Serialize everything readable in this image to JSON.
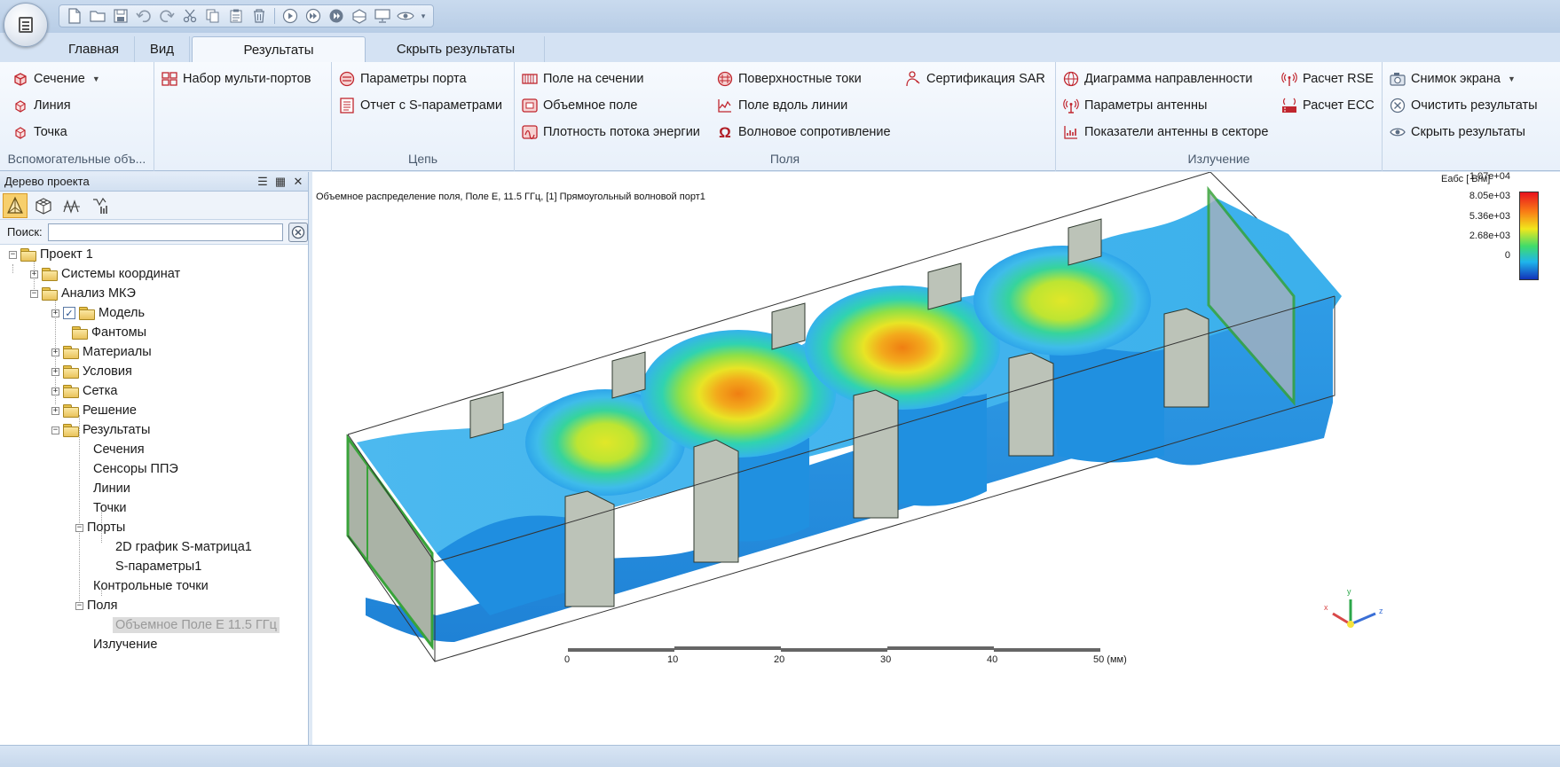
{
  "qat": {
    "icons": [
      "new-file-icon",
      "open-folder-icon",
      "save-icon",
      "undo-icon",
      "redo-icon",
      "cut-icon",
      "copy-icon",
      "paste-icon",
      "delete-icon",
      "play-icon",
      "step-icon",
      "run-icon",
      "mesh-icon",
      "screen-icon",
      "eye-icon"
    ]
  },
  "tabs": [
    {
      "label": "Главная"
    },
    {
      "label": "Вид"
    },
    {
      "label": "Результаты",
      "active": true
    },
    {
      "label": "Скрыть результаты"
    }
  ],
  "ribbon": {
    "aux": {
      "caption": "Вспомогательные объ...",
      "section": "Сечение",
      "line": "Линия",
      "point": "Точка"
    },
    "multiport": {
      "set": "Набор мульти-портов"
    },
    "circuit": {
      "caption": "Цепь",
      "port_params": "Параметры порта",
      "sparam_report": "Отчет с S-параметрами"
    },
    "fields": {
      "caption": "Поля",
      "field_section": "Поле на сечении",
      "volume_field": "Объемное поле",
      "power_density": "Плотность потока энергии",
      "surface_currents": "Поверхностные токи",
      "field_line": "Поле вдоль линии",
      "wave_impedance": "Волновое сопротивление",
      "wave_impedance_icon": "Ω",
      "sar_cert": "Сертификация SAR"
    },
    "radiation": {
      "caption": "Излучение",
      "pattern": "Диаграмма направленности",
      "antenna_params": "Параметры антенны",
      "sector_metrics": "Показатели антенны в секторе",
      "rse": "Расчет RSE",
      "ecc": "Расчет ECC"
    },
    "misc": {
      "screenshot": "Снимок экрана",
      "clear_results": "Очистить результаты",
      "hide_results": "Скрыть результаты"
    }
  },
  "tree_panel": {
    "title": "Дерево проекта",
    "search_label": "Поиск:",
    "search_value": "",
    "nodes": {
      "project": "Проект 1",
      "coord": "Системы координат",
      "fem": "Анализ МКЭ",
      "model": "Модель",
      "phantoms": "Фантомы",
      "materials": "Материалы",
      "conditions": "Условия",
      "mesh": "Сетка",
      "solution": "Решение",
      "results": "Результаты",
      "sections": "Сечения",
      "sensors": "Сенсоры ППЭ",
      "lines": "Линии",
      "points": "Точки",
      "ports": "Порты",
      "smatrix_plot": "2D график S-матрица1",
      "sparams": "S-параметры1",
      "checkpoints": "Контрольные точки",
      "fields": "Поля",
      "volume_field_e": "Объемное Поле Е 11.5 ГГц",
      "radiation": "Излучение"
    }
  },
  "viewport": {
    "caption": "Объемное распределение поля, Поле Е, 11.5 ГГц, [1] Прямоугольный волновой порт1",
    "legend": {
      "title": "Еабс [ В/м]",
      "values": [
        "1.07e+04",
        "8.05e+03",
        "5.36e+03",
        "2.68e+03",
        "0"
      ],
      "colors": [
        "#e8121e",
        "#f97c15",
        "#f1e71c",
        "#3fdc6b",
        "#1fb5ec",
        "#1232b8"
      ]
    },
    "scale": {
      "ticks": [
        "0",
        "10",
        "20",
        "30",
        "40",
        "50 (мм)"
      ]
    },
    "axes": {
      "x": "x",
      "y": "y",
      "z": "z"
    }
  }
}
